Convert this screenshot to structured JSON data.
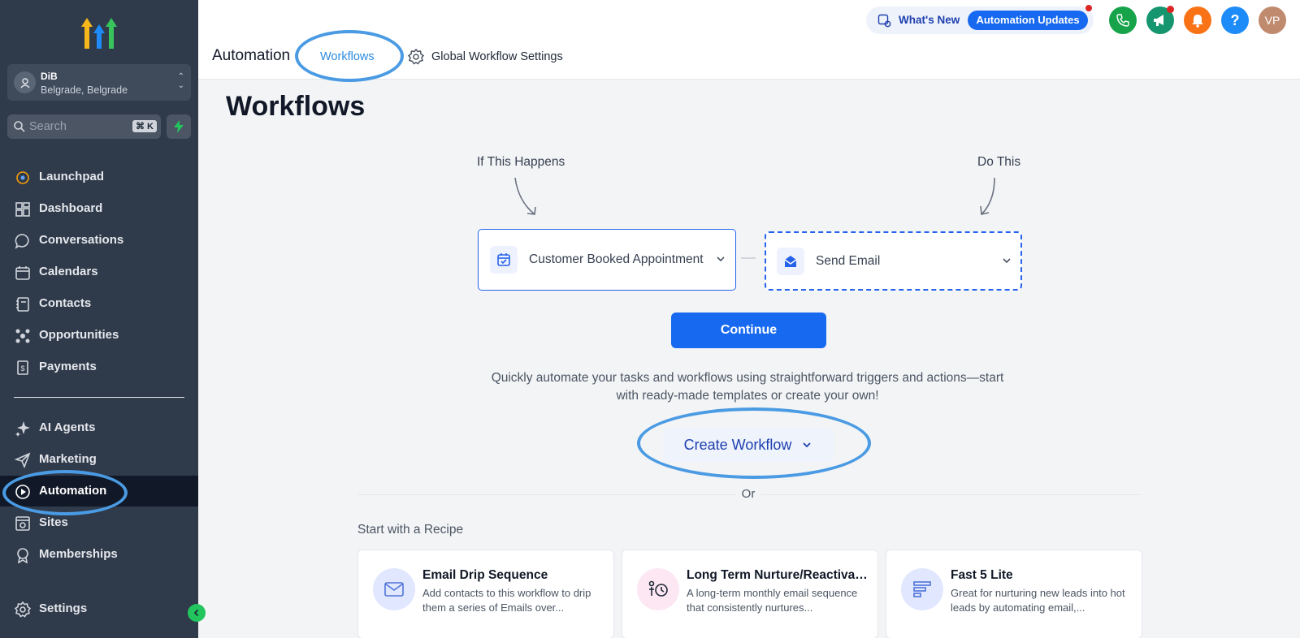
{
  "sidebar": {
    "location": {
      "name": "DiB",
      "city": "Belgrade, Belgrade"
    },
    "search": {
      "placeholder": "Search",
      "shortcut": "⌘ K"
    },
    "items": [
      {
        "label": "Launchpad",
        "icon": "launchpad-icon"
      },
      {
        "label": "Dashboard",
        "icon": "dashboard-grid-icon"
      },
      {
        "label": "Conversations",
        "icon": "chat-bubble-icon"
      },
      {
        "label": "Calendars",
        "icon": "calendar-icon"
      },
      {
        "label": "Contacts",
        "icon": "contacts-book-icon"
      },
      {
        "label": "Opportunities",
        "icon": "opportunities-icon"
      },
      {
        "label": "Payments",
        "icon": "payments-icon"
      },
      {
        "label": "AI Agents",
        "icon": "sparkle-icon"
      },
      {
        "label": "Marketing",
        "icon": "send-icon"
      },
      {
        "label": "Automation",
        "icon": "automation-play-icon",
        "active": true
      },
      {
        "label": "Sites",
        "icon": "sites-icon"
      },
      {
        "label": "Memberships",
        "icon": "award-icon"
      },
      {
        "label": "Settings",
        "icon": "gear-icon"
      }
    ]
  },
  "header": {
    "title": "Automation",
    "tab_workflows": "Workflows",
    "global_settings": "Global Workflow Settings",
    "whats_new": "What's New",
    "updates_pill": "Automation Updates",
    "help": "?",
    "avatar": "VP"
  },
  "main": {
    "title": "Workflows",
    "if_label": "If This Happens",
    "do_label": "Do This",
    "trigger": "Customer Booked Appointment",
    "action": "Send Email",
    "continue": "Continue",
    "description": "Quickly automate your tasks and workflows using straightforward triggers and actions—start with ready-made templates or create your own!",
    "create": "Create Workflow",
    "or": "Or",
    "recipe_title": "Start with a Recipe",
    "recipes": [
      {
        "title": "Email Drip Sequence",
        "desc": "Add contacts to this workflow to drip them a series of Emails over...",
        "icon": "mail-icon"
      },
      {
        "title": "Long Term Nurture/Reactivation",
        "desc": "A long-term monthly email sequence that consistently nurtures...",
        "icon": "nurture-clock-icon"
      },
      {
        "title": "Fast 5 Lite",
        "desc": "Great for nurturing new leads into hot leads by automating email,...",
        "icon": "funnel-icon"
      }
    ]
  },
  "colors": {
    "sidebar": "#2f3a4b",
    "primary": "#1769ef",
    "highlight_ring": "#4a9be3",
    "phone": "#16a34a",
    "megaphone": "#15966e",
    "bell": "#f97316",
    "help": "#1d8cf8",
    "avatar": "#c08a6e"
  }
}
